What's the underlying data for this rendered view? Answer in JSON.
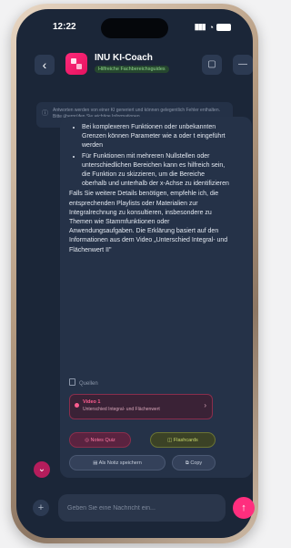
{
  "status": {
    "time": "12:22"
  },
  "header": {
    "title": "INU KI-Coach",
    "badge": "Hilfreiche Fachbereichsguides",
    "back_icon": "chevron-left-icon",
    "bookmark_icon": "bookmark-icon",
    "menu_icon": "more-icon"
  },
  "notice": {
    "text": "Antworten werden von einer KI generiert und können gelegentlich Fehler enthalten. Bitte überprüfen Sie wichtige Informationen."
  },
  "message": {
    "bullets": [
      "Bei komplexeren Funktionen oder unbekannten Grenzen können Parameter wie a oder t eingeführt werden",
      "Für Funktionen mit mehreren Nullstellen oder unterschiedlichen Bereichen kann es hilfreich sein, die Funktion zu skizzieren, um die Bereiche oberhalb und unterhalb der x-Achse zu identifizieren"
    ],
    "paragraph": "Falls Sie weitere Details benötigen, empfehle ich, die entsprechenden Playlists oder Materialien zur Integralrechnung zu konsultieren, insbesondere zu Themen wie Stammfunktionen oder Anwendungsaufgaben. Die Erklärung basiert auf den Informationen aus dem Video „Unterschied Integral- und Flächenwert II\""
  },
  "sources": {
    "label": "Quellen",
    "card_title": "Video 1",
    "card_subtitle": "Unterschied Integral- und Flächenwert"
  },
  "actions": {
    "notes": "Notes Quiz",
    "flashcards": "Flashcards",
    "save_note": "Als Notiz speichern",
    "copy": "Copy"
  },
  "composer": {
    "placeholder": "Geben Sie eine Nachricht ein..."
  },
  "colors": {
    "accent": "#ff2e7e",
    "background": "#1b2638"
  }
}
